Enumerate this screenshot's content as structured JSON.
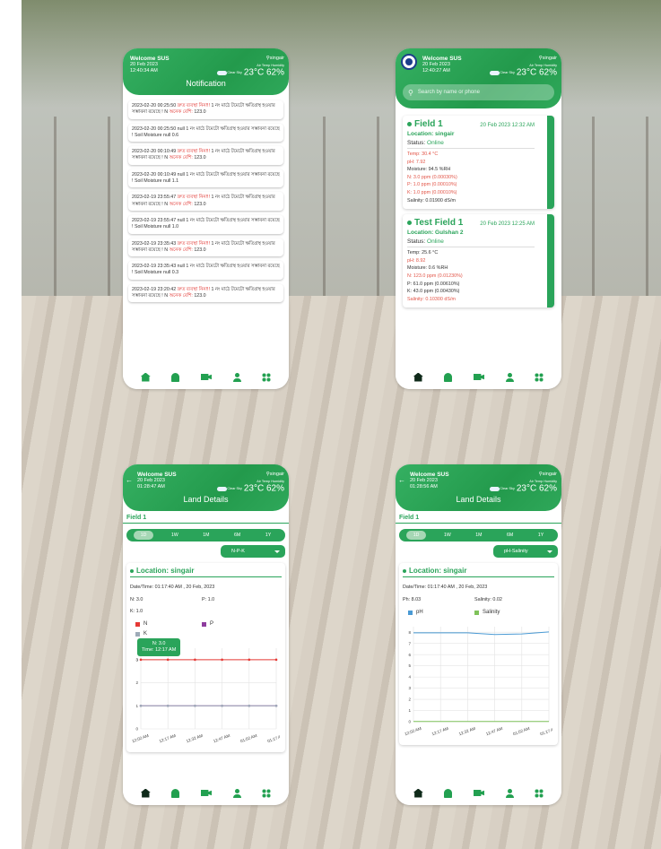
{
  "colors": {
    "green": "#2aa45a",
    "red": "#e0302c",
    "n_series": "#e53935",
    "p_series": "#8e3c9e",
    "k_series": "#9eabb8",
    "ph_series": "#4a9ad4",
    "salinity_series": "#7fc25a"
  },
  "header": {
    "welcome": "Welcome SUS",
    "location": "singair",
    "air_temp_label": "Air Temp",
    "humidity_label": "Humidity",
    "sky": "Clear Sky",
    "temp": "23°C",
    "humidity": "62%",
    "weather_icon": "cloud-icon"
  },
  "screens": {
    "notification": {
      "date": "20 Feb 2023",
      "time": "12:40:34 AM",
      "title": "Notification",
      "items": [
        {
          "prefix": "2023-02-20 00:25:50 ",
          "alert": "দ্রুত ব্যবস্থা নিন!!!",
          "mid": " 1 নং মাঠে টমেটো ক্ষতিগ্রস্থ হওয়ার সম্ভাবনা রয়েছে ! N ",
          "alert2": "অনেক বেশি:",
          "suffix": " 123.0"
        },
        {
          "prefix": "2023-02-20 00:25:50 null 1 নং মাঠে টমেটো ক্ষতিগ্রস্থ হওয়ার সম্ভাবনা রয়েছে ! Soil Moisture null 0.6",
          "alert": "",
          "mid": "",
          "alert2": "",
          "suffix": ""
        },
        {
          "prefix": "2023-02-20 00:10:49 ",
          "alert": "দ্রুত ব্যবস্থা নিন!!!",
          "mid": " 1 নং মাঠে টমেটো ক্ষতিগ্রস্থ হওয়ার সম্ভাবনা রয়েছে ! N ",
          "alert2": "অনেক বেশি:",
          "suffix": " 123.0"
        },
        {
          "prefix": "2023-02-20 00:10:49 null 1 নং মাঠে টমেটো ক্ষতিগ্রস্থ হওয়ার সম্ভাবনা রয়েছে ! Soil Moisture null 1.1",
          "alert": "",
          "mid": "",
          "alert2": "",
          "suffix": ""
        },
        {
          "prefix": "2023-02-19 23:55:47 ",
          "alert": "দ্রুত ব্যবস্থা নিন!!!",
          "mid": " 1 নং মাঠে টমেটো ক্ষতিগ্রস্থ হওয়ার সম্ভাবনা রয়েছে ! N ",
          "alert2": "অনেক বেশি:",
          "suffix": " 123.0"
        },
        {
          "prefix": "2023-02-19 23:55:47 null 1 নং মাঠে টমেটো ক্ষতিগ্রস্থ হওয়ার সম্ভাবনা রয়েছে ! Soil Moisture null 1.0",
          "alert": "",
          "mid": "",
          "alert2": "",
          "suffix": ""
        },
        {
          "prefix": "2023-02-19 23:35:43 ",
          "alert": "দ্রুত ব্যবস্থা নিন!!!",
          "mid": " 1 নং মাঠে টমেটো ক্ষতিগ্রস্থ হওয়ার সম্ভাবনা রয়েছে ! N ",
          "alert2": "অনেক বেশি:",
          "suffix": " 123.0"
        },
        {
          "prefix": "2023-02-19 23:35:43 null 1 নং মাঠে টমেটো ক্ষতিগ্রস্থ হওয়ার সম্ভাবনা রয়েছে ! Soil Moisture null 0.3",
          "alert": "",
          "mid": "",
          "alert2": "",
          "suffix": ""
        },
        {
          "prefix": "2023-02-19 23:20:42 ",
          "alert": "দ্রুত ব্যবস্থা নিন!!!",
          "mid": " 1 নং মাঠে টমেটো ক্ষতিগ্রস্থ হওয়ার সম্ভাবনা রয়েছে ! N ",
          "alert2": "অনেক বেশি:",
          "suffix": " 123.0"
        }
      ]
    },
    "fields": {
      "date": "20 Feb 2023",
      "time": "12:40:27 AM",
      "search_placeholder": "Search by name or phone",
      "cards": [
        {
          "name": "Field 1",
          "date": "20 Feb 2023 12:32 AM",
          "location": "Location: singair",
          "status_label": "Status: ",
          "status": "Online",
          "lines": [
            {
              "text": "Temp: 30.4 °C",
              "red": true
            },
            {
              "text": "pH: 7.92",
              "red": true
            },
            {
              "text": "Moisture: 94.5 %RH",
              "red": false
            },
            {
              "text": "N: 3.0 ppm (0.00030%)",
              "red": true
            },
            {
              "text": "P: 1.0 ppm (0.00010%)",
              "red": true
            },
            {
              "text": "K: 1.0 ppm (0.00010%)",
              "red": true
            },
            {
              "text": "Salinity: 0.01900 dS/m",
              "red": false
            }
          ]
        },
        {
          "name": "Test Field 1",
          "date": "20 Feb 2023 12:25 AM",
          "location": "Location: Gulshan 2",
          "status_label": "Status: ",
          "status": "Online",
          "lines": [
            {
              "text": "Temp: 25.6 °C",
              "red": false
            },
            {
              "text": "pH: 8.92",
              "red": true
            },
            {
              "text": "Moisture: 0.6 %RH",
              "red": false
            },
            {
              "text": "N: 123.0 ppm (0.01230%)",
              "red": true
            },
            {
              "text": "P: 61.0 ppm (0.00610%)",
              "red": false
            },
            {
              "text": "K: 43.0 ppm (0.00430%)",
              "red": false
            },
            {
              "text": "Salinity: 0.10300 dS/m",
              "red": true
            }
          ]
        }
      ]
    },
    "land_npk": {
      "date": "20 Feb 2023",
      "time": "01:28:47 AM",
      "title": "Land Details",
      "field": "Field 1",
      "periods": [
        "1D",
        "1W",
        "1M",
        "6M",
        "1Y"
      ],
      "selected_period": "1D",
      "dropdown": "N-P-K",
      "location": "Location: singair",
      "datetime": "Date/Time:  01:17:40 AM , 20 Feb, 2023",
      "v1": "N:  3.0",
      "v2": "P:  1.0",
      "v3": "K: 1.0",
      "legend": [
        "N",
        "P",
        "K"
      ],
      "tooltip_line1": "N: 3.0",
      "tooltip_line2": "Time: 12:17 AM"
    },
    "land_ph": {
      "date": "20 Feb 2023",
      "time": "01:28:56 AM",
      "title": "Land Details",
      "field": "Field 1",
      "periods": [
        "1D",
        "1W",
        "1M",
        "6M",
        "1Y"
      ],
      "selected_period": "1D",
      "dropdown": "pH-Salinity",
      "location": "Location: singair",
      "datetime": "Date/Time:  01:17:40 AM , 20 Feb, 2023",
      "v1": "Ph:  8.03",
      "v2": "Salinity: 0.02",
      "legend": [
        "pH",
        "Salinity"
      ]
    }
  },
  "nav_icons": [
    "home-icon",
    "bell-icon",
    "video-icon",
    "user-icon",
    "grid-icon"
  ],
  "chart_data": [
    {
      "type": "line",
      "categories": [
        "12:02 AM",
        "12:17 AM",
        "12:32 AM",
        "12:47 AM",
        "01:02 AM",
        "01:17 AM"
      ],
      "series": [
        {
          "name": "N",
          "values": [
            3,
            3,
            3,
            3,
            3,
            3
          ]
        },
        {
          "name": "P",
          "values": [
            1,
            1,
            1,
            1,
            1,
            1
          ]
        },
        {
          "name": "K",
          "values": [
            1,
            1,
            1,
            1,
            1,
            1
          ]
        }
      ],
      "y_ticks": [
        "0",
        "1",
        "2",
        "3",
        "3"
      ],
      "ylim": [
        0,
        3.5
      ]
    },
    {
      "type": "line",
      "categories": [
        "12:02 AM",
        "12:17 AM",
        "12:32 AM",
        "12:47 AM",
        "01:02 AM",
        "01:17 AM"
      ],
      "series": [
        {
          "name": "pH",
          "values": [
            7.95,
            7.95,
            7.95,
            7.8,
            7.85,
            8.03
          ]
        },
        {
          "name": "Salinity",
          "values": [
            0.02,
            0.02,
            0.02,
            0.02,
            0.02,
            0.02
          ]
        }
      ],
      "y_ticks": [
        "0",
        "1",
        "2",
        "3",
        "4",
        "5",
        "6",
        "7",
        "8"
      ],
      "ylim": [
        0,
        8.5
      ]
    }
  ]
}
